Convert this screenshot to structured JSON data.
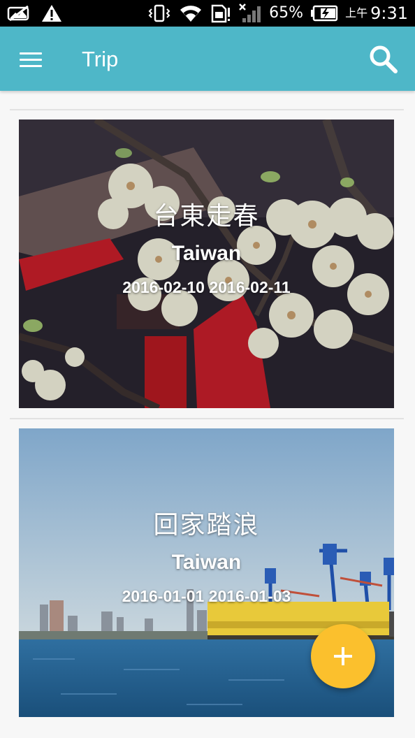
{
  "status_bar": {
    "battery_percent": "65%",
    "ampm": "上午",
    "time": "9:31",
    "icons": [
      "photo-off-icon",
      "warning-icon",
      "vibrate-icon",
      "wifi-icon",
      "sim-icon",
      "cell-signal-icon",
      "battery-charging-icon"
    ]
  },
  "app_bar": {
    "title": "Trip",
    "background_color": "#4eb7c8",
    "menu_icon": "hamburger-menu-icon",
    "search_icon": "search-icon"
  },
  "trips": [
    {
      "title": "台東走春",
      "country": "Taiwan",
      "dates": "2016-02-10 2016-02-11"
    },
    {
      "title": "回家踏浪",
      "country": "Taiwan",
      "dates": "2016-01-01 2016-01-03"
    }
  ],
  "fab": {
    "icon": "plus-icon",
    "color": "#fbc02d"
  }
}
